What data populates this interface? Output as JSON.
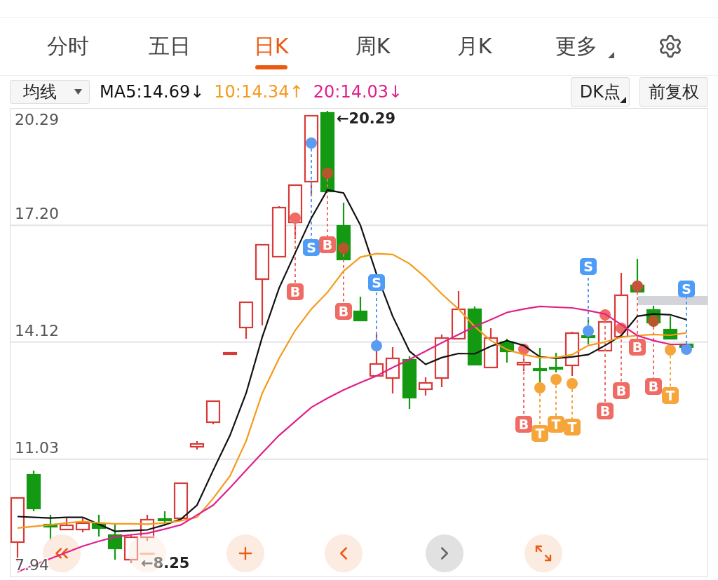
{
  "tabs": [
    {
      "label": "分时",
      "selected": false,
      "kind": "plain"
    },
    {
      "label": "五日",
      "selected": false,
      "kind": "plain"
    },
    {
      "label": "日K",
      "selected": true,
      "kind": "plain"
    },
    {
      "label": "周K",
      "selected": false,
      "kind": "plain"
    },
    {
      "label": "月K",
      "selected": false,
      "kind": "plain"
    },
    {
      "label": "更多",
      "selected": false,
      "kind": "menu"
    }
  ],
  "toolbar": {
    "indicator_select": {
      "value": "均线"
    },
    "ma": [
      {
        "label": "MA5:14.69↓",
        "color": "#111111"
      },
      {
        "label": "10:14.34↑",
        "color": "#f59a1b"
      },
      {
        "label": "20:14.03↓",
        "color": "#e0208a"
      }
    ],
    "buttons": [
      {
        "label": "DK点",
        "kind": "menu"
      },
      {
        "label": "前复权",
        "kind": "plain"
      }
    ]
  },
  "chart": {
    "max_label": "20.29",
    "chart_data": {
      "type": "line",
      "grid": true,
      "ylim": [
        7.94,
        20.29
      ],
      "yticks": [
        {
          "value": 17.2,
          "label": "17.20"
        },
        {
          "value": 14.12,
          "label": "14.12"
        },
        {
          "value": 11.03,
          "label": "11.03"
        },
        {
          "value": 7.94,
          "label": "7.94"
        }
      ],
      "series": [
        {
          "color": "#111111",
          "values": [
            9.52,
            9.5,
            9.48,
            9.5,
            9.5,
            9.32,
            9.13,
            9.15,
            9.17,
            9.3,
            9.45,
            9.82,
            10.74,
            11.66,
            12.77,
            14.25,
            15.54,
            16.47,
            17.39,
            18.13,
            18.05,
            17.2,
            15.91,
            14.8,
            13.88,
            13.53,
            13.71,
            13.82,
            13.81,
            14.01,
            14.16,
            14.03,
            13.73,
            13.69,
            13.73,
            13.79,
            14.03,
            14.29,
            14.8,
            14.86,
            14.84,
            14.71
          ]
        },
        {
          "color": "#f59a1b",
          "values": [
            9.22,
            9.26,
            9.3,
            9.35,
            9.39,
            9.35,
            9.33,
            9.33,
            9.32,
            9.35,
            9.41,
            9.5,
            10.0,
            10.59,
            11.51,
            12.77,
            13.69,
            14.43,
            14.99,
            15.43,
            15.99,
            16.36,
            16.45,
            16.43,
            16.19,
            15.82,
            15.39,
            14.99,
            14.53,
            14.16,
            13.92,
            13.79,
            13.71,
            13.71,
            13.79,
            14.03,
            14.12,
            14.25,
            14.29,
            14.32,
            14.3,
            14.36
          ]
        },
        {
          "color": "#e0208a",
          "values": [
            8.06,
            8.24,
            null,
            null,
            8.74,
            8.87,
            8.98,
            9.04,
            9.08,
            9.19,
            9.3,
            9.56,
            9.82,
            10.28,
            10.74,
            11.2,
            11.66,
            12.03,
            12.4,
            12.64,
            12.86,
            13.05,
            13.23,
            13.45,
            13.66,
            13.88,
            14.1,
            14.32,
            14.53,
            14.71,
            14.9,
            14.99,
            15.06,
            15.04,
            15.02,
            14.95,
            14.86,
            14.58,
            14.29,
            14.16,
            14.06,
            14.06
          ]
        }
      ]
    },
    "high_label": "←20.29",
    "low_label": "←8.25",
    "signals": [
      {
        "kind": "buy",
        "label": "B"
      },
      {
        "kind": "sell",
        "label": "S"
      },
      {
        "kind": "buy",
        "label": "B"
      },
      {
        "kind": "buy",
        "label": "B"
      },
      {
        "kind": "sell",
        "label": "S"
      },
      {
        "kind": "buy",
        "label": "B"
      },
      {
        "kind": "t",
        "label": "T"
      },
      {
        "kind": "t",
        "label": "T"
      },
      {
        "kind": "t",
        "label": "T"
      },
      {
        "kind": "sell",
        "label": "S"
      },
      {
        "kind": "buy",
        "label": "B"
      },
      {
        "kind": "buy",
        "label": "B"
      },
      {
        "kind": "buy",
        "label": "B"
      },
      {
        "kind": "buy",
        "label": "B"
      },
      {
        "kind": "t",
        "label": "T"
      },
      {
        "kind": "sell",
        "label": "S"
      }
    ],
    "controls": [
      {
        "kind": "first",
        "disabled": false
      },
      {
        "kind": "zoom_out",
        "disabled": true
      },
      {
        "kind": "zoom_in",
        "disabled": false
      },
      {
        "kind": "prev",
        "disabled": false
      },
      {
        "kind": "next",
        "disabled": true
      },
      {
        "kind": "expand",
        "disabled": false
      }
    ]
  }
}
